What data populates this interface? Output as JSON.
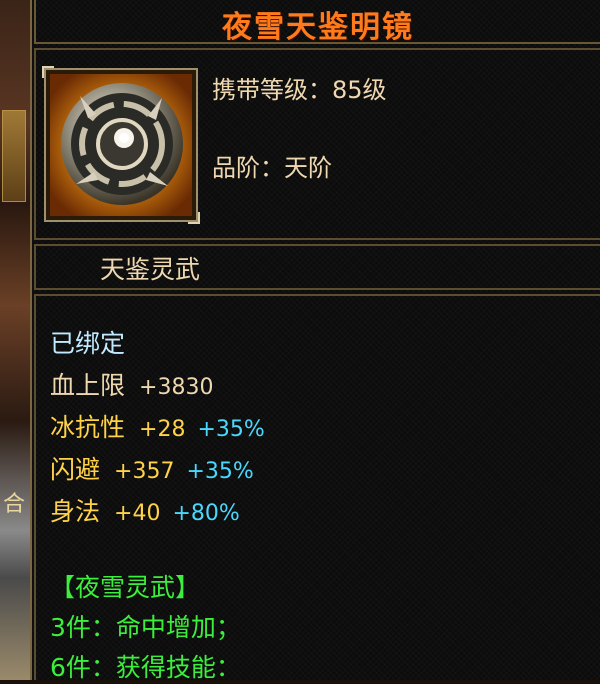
{
  "item": {
    "title": "夜雪天鉴明镜",
    "icon": "mirror-weapon-icon",
    "carry_level": "携带等级：85级",
    "grade": "品阶：天阶",
    "subtitle": "天鉴灵武"
  },
  "attributes": {
    "bound": "已绑定",
    "stats": [
      {
        "name": "血上限",
        "value": "+3830",
        "bonus": ""
      },
      {
        "name": "冰抗性",
        "value": "+28",
        "bonus": "+35%"
      },
      {
        "name": "闪避",
        "value": "+357",
        "bonus": "+35%"
      },
      {
        "name": "身法",
        "value": "+40",
        "bonus": "+80%"
      }
    ],
    "set_title": "【夜雪灵武】",
    "set_bonuses": [
      "3件：命中增加；",
      "6件：获得技能："
    ]
  },
  "background": {
    "glyph": "合"
  },
  "colors": {
    "title": "#ff7a1a",
    "tan": "#efd8b0",
    "yellow": "#ffd24a",
    "cyan_label": "#bfeaff",
    "cyan_value": "#4ad8ff",
    "green": "#3cef3c",
    "border": "#5c4c30"
  }
}
